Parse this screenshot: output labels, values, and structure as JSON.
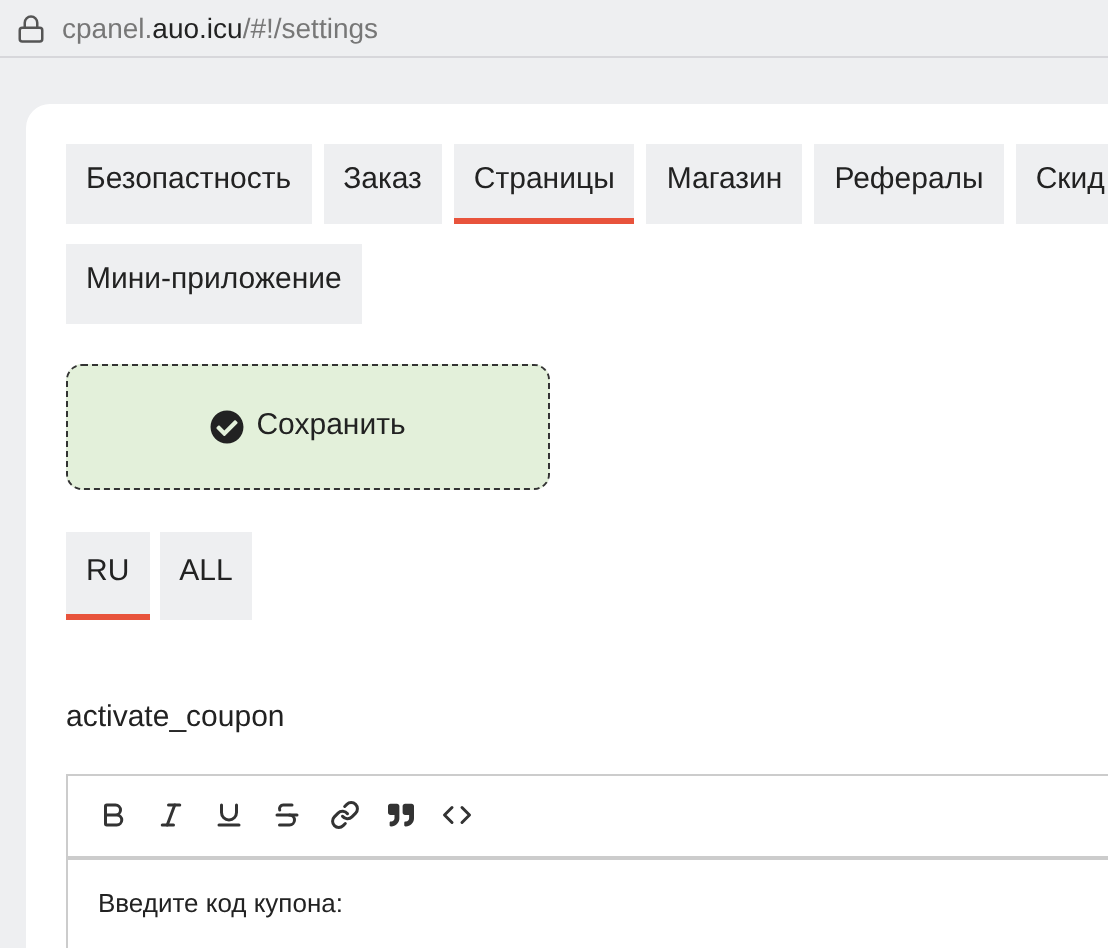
{
  "address_bar": {
    "host_prefix": "cpanel.",
    "domain": "auo.icu",
    "path": "/#!/settings"
  },
  "tabs": [
    {
      "label": "Безопастность",
      "selected": false
    },
    {
      "label": "Заказ",
      "selected": false
    },
    {
      "label": "Страницы",
      "selected": true
    },
    {
      "label": "Магазин",
      "selected": false
    },
    {
      "label": "Рефералы",
      "selected": false
    },
    {
      "label": "Скид",
      "selected": false
    },
    {
      "label": "Мини-приложение",
      "selected": false
    }
  ],
  "save_button": {
    "label": "Сохранить"
  },
  "language_tabs": [
    {
      "label": "RU",
      "selected": true
    },
    {
      "label": "ALL",
      "selected": false
    }
  ],
  "field": {
    "label": "activate_coupon",
    "value": "Введите код купона:"
  }
}
